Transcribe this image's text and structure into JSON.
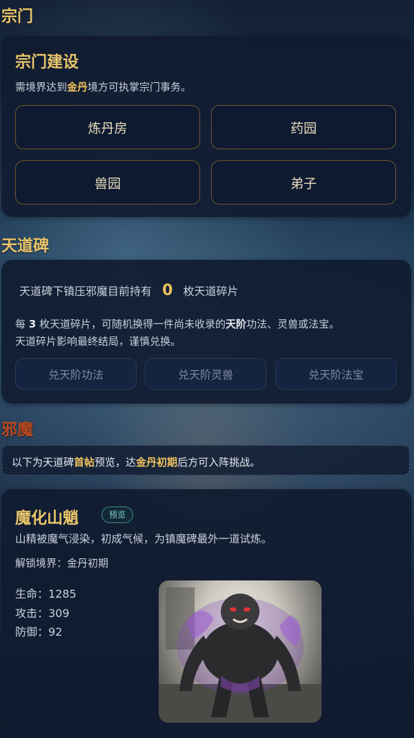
{
  "sect": {
    "section_title": "宗门",
    "card_title": "宗门建设",
    "desc_pre": "需境界达到",
    "desc_hl": "金丹",
    "desc_post": "境方可执掌宗门事务。",
    "buttons": [
      "炼丹房",
      "药园",
      "兽园",
      "弟子"
    ]
  },
  "stele": {
    "section_title": "天道碑",
    "count_pre": "天道碑下镇压邪魔目前持有",
    "count_value": "0",
    "count_post": "枚天道碎片",
    "rule_a": "每",
    "rule_num": "3",
    "rule_b": "枚天道碎片，可随机换得一件尚未收录的",
    "rule_hl": "天阶",
    "rule_c": "功法、灵兽或法宝。",
    "rule_line2": "天道碎片影响最终结局，谨慎兑换。",
    "exchange_buttons": [
      "兑天阶功法",
      "兑天阶灵兽",
      "兑天阶法宝"
    ]
  },
  "evil": {
    "section_title": "邪魔",
    "notice_a": "以下为天道碑",
    "notice_hl1": "首帖",
    "notice_b": "预览，达",
    "notice_hl2": "金丹初期",
    "notice_c": "后方可入阵挑战。"
  },
  "monster": {
    "name": "魔化山魈",
    "tag": "预览",
    "desc": "山精被魔气浸染，初成气候，为镇魔碑最外一道试炼。",
    "unlock": "解锁境界：金丹初期",
    "stats": [
      "生命：1285",
      "攻击：309",
      "防御：92"
    ],
    "portrait_icon": "monster-portrait"
  },
  "colors": {
    "gold": "#e9c46a",
    "evil_red": "#b9481f",
    "card_bg": "#101b30",
    "tag_teal": "#7fd1c6"
  }
}
